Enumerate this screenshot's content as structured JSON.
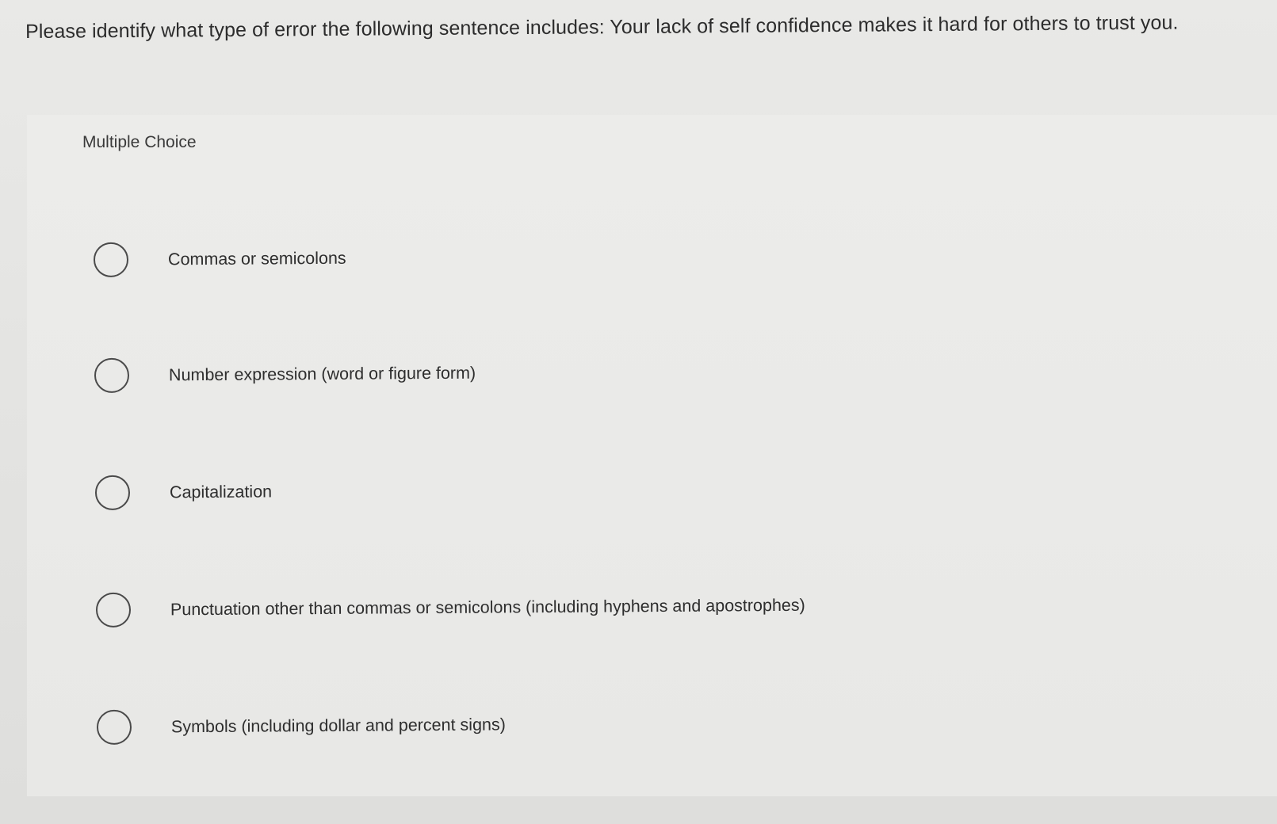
{
  "question": {
    "text": "Please identify what type of error the following sentence includes: Your lack of self confidence makes it hard for others to trust you."
  },
  "multiple_choice_label": "Multiple Choice",
  "options": [
    {
      "label": "Commas or semicolons",
      "selected": false
    },
    {
      "label": "Number expression (word or figure form)",
      "selected": false
    },
    {
      "label": "Capitalization",
      "selected": false
    },
    {
      "label": "Punctuation other than commas or semicolons (including hyphens and apostrophes)",
      "selected": false
    },
    {
      "label": "Symbols (including dollar and percent signs)",
      "selected": false
    }
  ]
}
